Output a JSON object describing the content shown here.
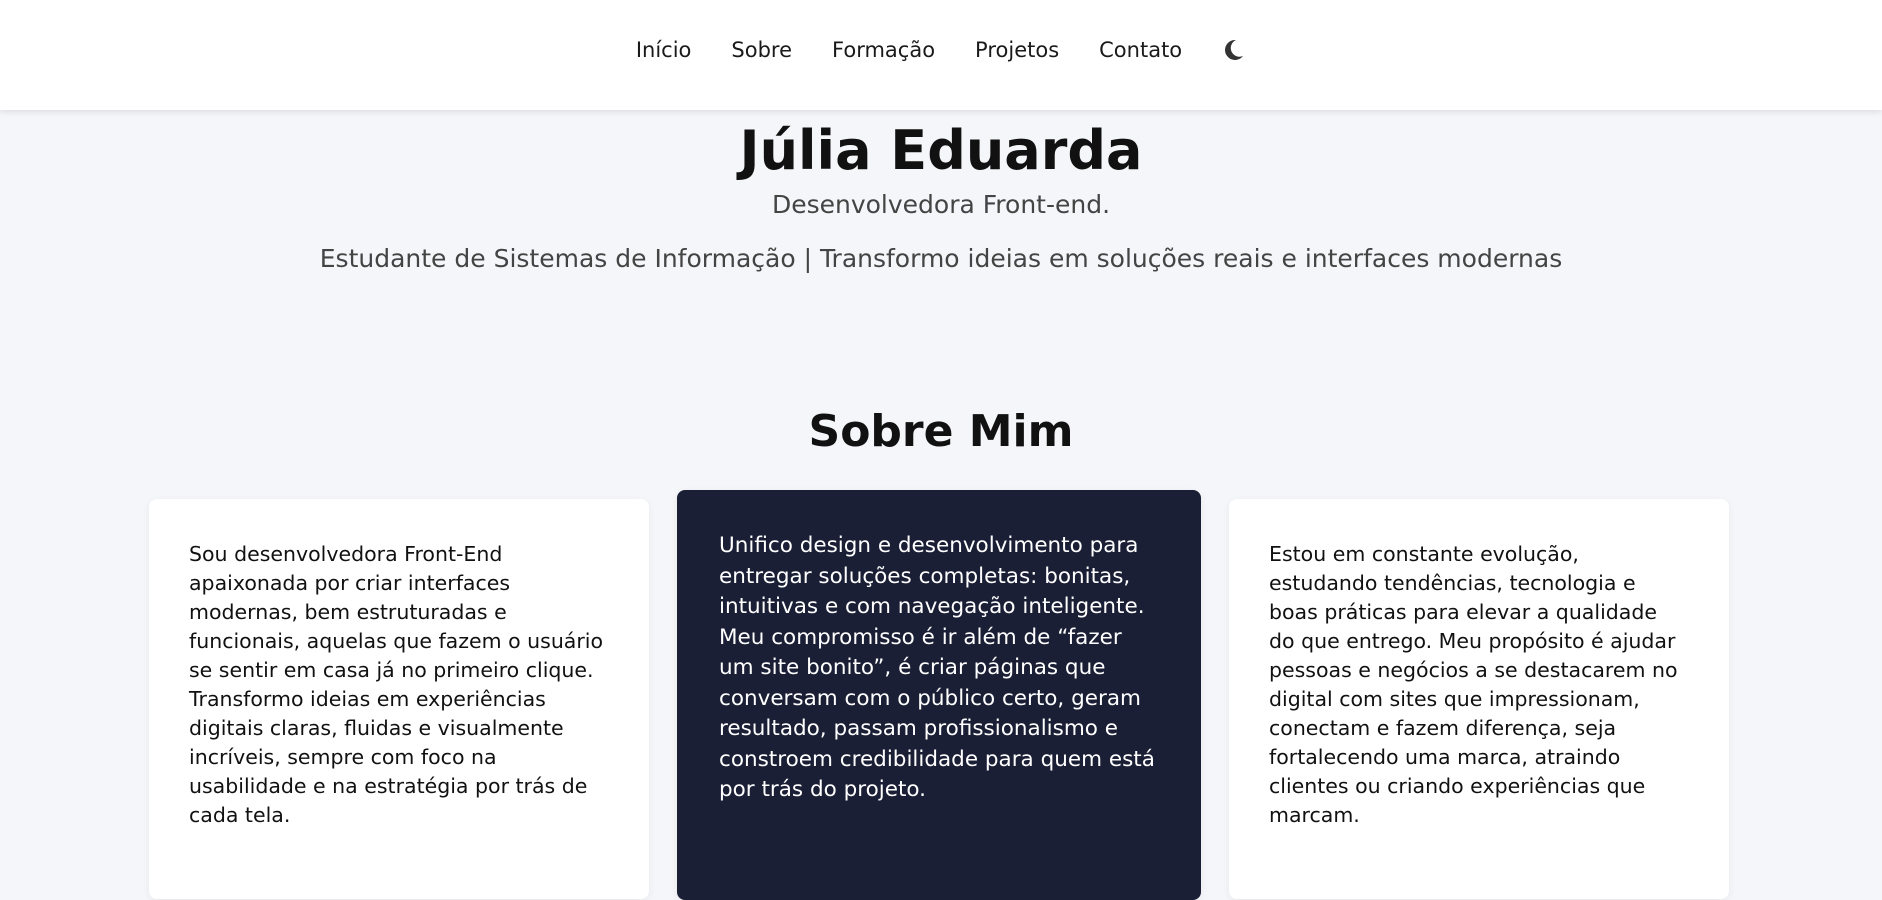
{
  "nav": {
    "items": [
      "Início",
      "Sobre",
      "Formação",
      "Projetos",
      "Contato"
    ],
    "theme_toggle_icon": "moon-icon"
  },
  "hero": {
    "name": "Júlia Eduarda",
    "role": "Desenvolvedora Front-end.",
    "tagline": "Estudante de Sistemas de Informação | Transformo ideias em soluções reais e interfaces modernas"
  },
  "about": {
    "title": "Sobre Mim",
    "cards": [
      "Sou desenvolvedora Front-End apaixonada por criar interfaces modernas, bem estruturadas e funcionais, aquelas que fazem o usuário se sentir em casa já no primeiro clique. Transformo ideias em experiências digitais claras, fluidas e visualmente incríveis, sempre com foco na usabilidade e na estratégia por trás de cada tela.",
      "Unifico design e desenvolvimento para entregar soluções completas: bonitas, intuitivas e com navegação inteligente. Meu compromisso é ir além de “fazer um site bonito”, é criar páginas que conversam com o público certo, geram resultado, passam profissionalismo e constroem credibilidade para quem está por trás do projeto.",
      "Estou em constante evolução, estudando tendências, tecnologia e boas práticas para elevar a qualidade do que entrego. Meu propósito é ajudar pessoas e negócios a se destacarem no digital com sites que impressionam, conectam e fazem diferença, seja fortalecendo uma marca, atraindo clientes ou criando experiências que marcam."
    ]
  },
  "colors": {
    "page_background": "#f5f6f9",
    "navbar_background": "#ffffff",
    "highlight_card": "#1b1f36",
    "text": "#111111",
    "muted_text": "#444444"
  }
}
